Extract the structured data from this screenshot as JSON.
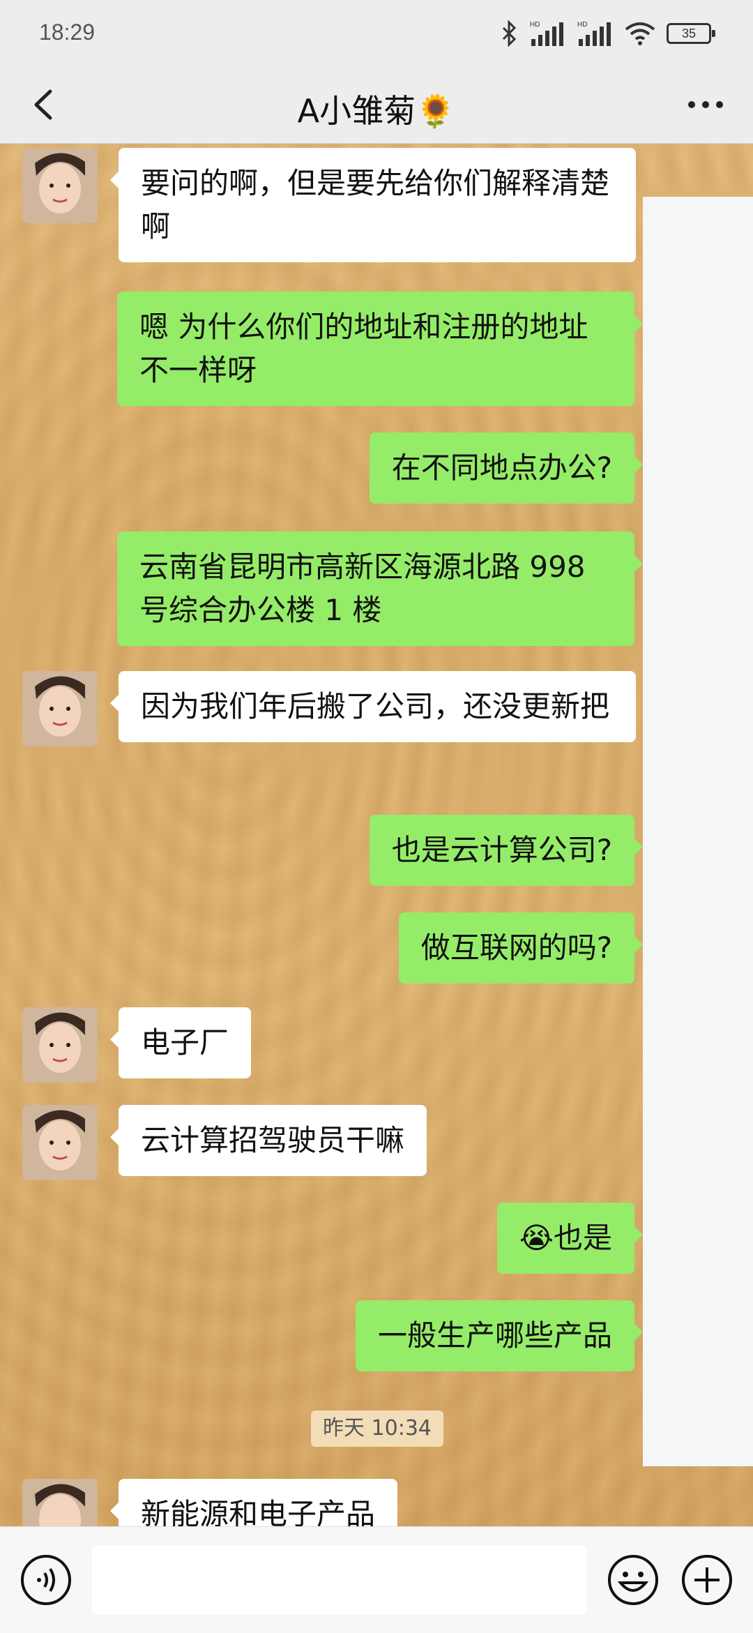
{
  "status_bar": {
    "time": "18:29",
    "battery": "35"
  },
  "header": {
    "title": "A小雏菊🌻"
  },
  "messages": [
    {
      "side": "left",
      "text": "要问的啊，但是要先给你们解释清楚啊"
    },
    {
      "side": "right",
      "text": "嗯  为什么你们的地址和注册的地址不一样呀"
    },
    {
      "side": "right",
      "text": "在不同地点办公?"
    },
    {
      "side": "right",
      "text": "云南省昆明市高新区海源北路 998 号综合办公楼 1 楼"
    },
    {
      "side": "left",
      "text": "因为我们年后搬了公司，还没更新把"
    },
    {
      "side": "right",
      "text": "也是云计算公司?"
    },
    {
      "side": "right",
      "text": "做互联网的吗?"
    },
    {
      "side": "left",
      "text": "电子厂"
    },
    {
      "side": "left",
      "text": "云计算招驾驶员干嘛"
    },
    {
      "side": "right",
      "text": "😭也是"
    },
    {
      "side": "right",
      "text": "一般生产哪些产品"
    },
    {
      "side": "left",
      "text": "新能源和电子产品"
    }
  ],
  "timestamp": "昨天  10:34",
  "icons": {
    "back": "chevron-left-icon",
    "more": "more-dots-icon",
    "voice": "voice-icon",
    "emoji": "emoji-icon",
    "plus": "plus-icon"
  },
  "colors": {
    "sent_bubble": "#95ec69",
    "received_bubble": "#ffffff"
  }
}
